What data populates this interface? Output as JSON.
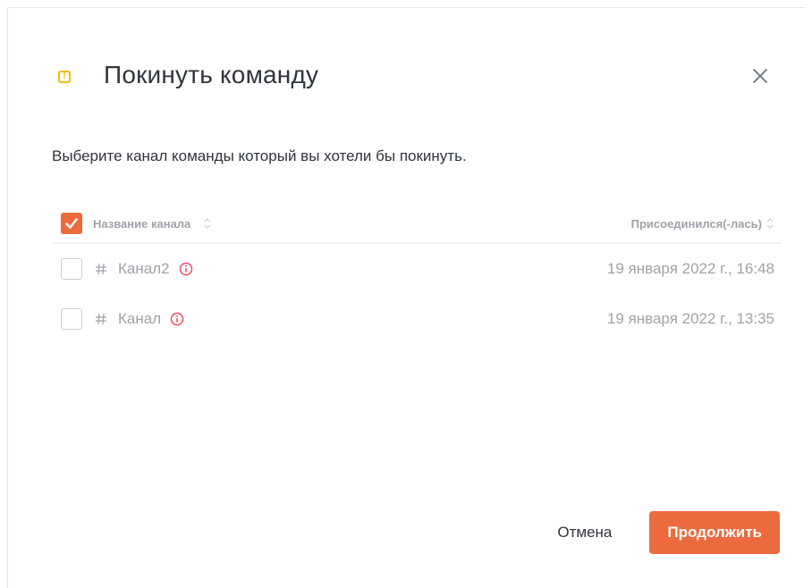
{
  "modal": {
    "title": "Покинуть команду",
    "subtitle": "Выберите канал команды который вы хотели бы покинуть.",
    "close_icon": "close-icon",
    "warning_icon": "warning-icon"
  },
  "table": {
    "columns": {
      "name": "Название канала",
      "joined": "Присоединился(-лась)"
    },
    "rows": [
      {
        "name": "Канал2",
        "joined": "19 января 2022 г., 16:48",
        "checked": false
      },
      {
        "name": "Канал",
        "joined": "19 января 2022 г., 13:35",
        "checked": false
      }
    ]
  },
  "footer": {
    "cancel_label": "Отмена",
    "continue_label": "Продолжить"
  },
  "colors": {
    "accent": "#ec6b3e",
    "warning": "#f3be08",
    "info": "#f5455c",
    "muted_text": "#9ea2a8"
  }
}
